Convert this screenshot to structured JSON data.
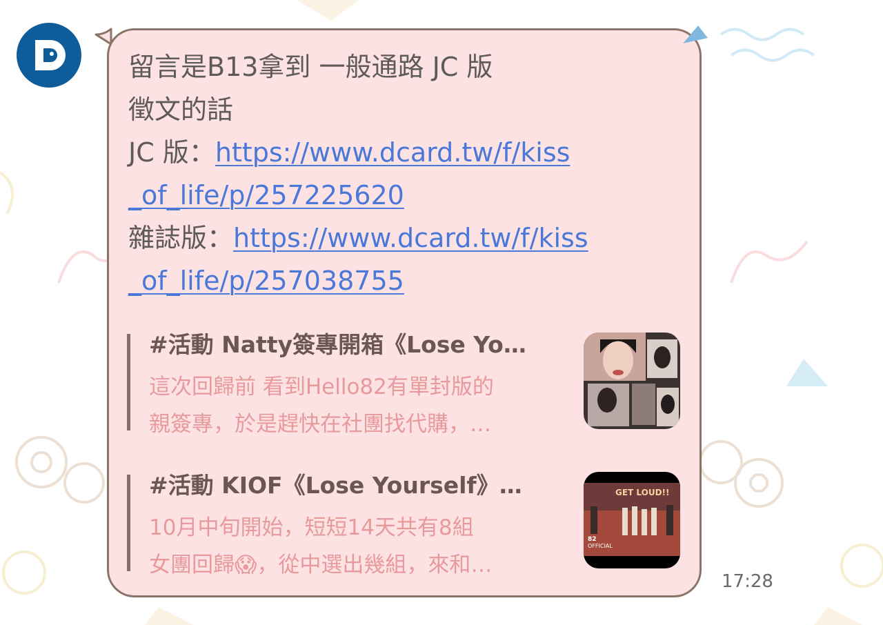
{
  "chat": {
    "message": {
      "line1": "留言是B13拿到 一般通路 JC 版",
      "line2": "徵文的話",
      "jc_label": "JC 版：",
      "jc_link_part1": "https://www.dcard.tw/f/kiss",
      "jc_link_part2": "_of_life/p/257225620",
      "mag_label": "雜誌版：",
      "mag_link_part1": "https://www.dcard.tw/f/kiss",
      "mag_link_part2": "_of_life/p/257038755"
    },
    "previews": [
      {
        "title": "#活動 Natty簽專開箱《Lose Yo…",
        "desc_line1": "這次回歸前 看到Hello82有單封版的",
        "desc_line2": "親簽專，於是趕快在社團找代購，…"
      },
      {
        "title": "#活動 KIOF《Lose Yourself》…",
        "desc_line1": "10月中旬開始，短短14天共有8組",
        "desc_line2_before": "女團回歸",
        "desc_emoji": "😱",
        "desc_line2_after": "，從中選出幾組，來和…",
        "thumb_text": "GET LOUD!!",
        "thumb_logo": "82\nOFFICIAL"
      }
    ],
    "time": "17:28"
  },
  "colors": {
    "bubble_bg": "#fde2e4",
    "bubble_border": "#8a7367",
    "link": "#4a78d9",
    "preview_desc": "#e79a9c",
    "avatar_bg": "#0e5d9a"
  },
  "icons": {
    "avatar": "dcard-logo-icon",
    "emoji": "screaming-face-emoji"
  }
}
